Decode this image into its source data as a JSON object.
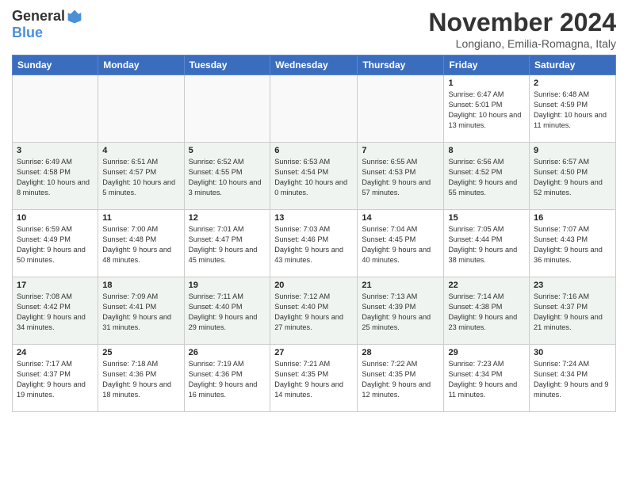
{
  "logo": {
    "general": "General",
    "blue": "Blue"
  },
  "header": {
    "title": "November 2024",
    "location": "Longiano, Emilia-Romagna, Italy"
  },
  "weekdays": [
    "Sunday",
    "Monday",
    "Tuesday",
    "Wednesday",
    "Thursday",
    "Friday",
    "Saturday"
  ],
  "weeks": [
    [
      {
        "day": "",
        "info": ""
      },
      {
        "day": "",
        "info": ""
      },
      {
        "day": "",
        "info": ""
      },
      {
        "day": "",
        "info": ""
      },
      {
        "day": "",
        "info": ""
      },
      {
        "day": "1",
        "info": "Sunrise: 6:47 AM\nSunset: 5:01 PM\nDaylight: 10 hours and 13 minutes."
      },
      {
        "day": "2",
        "info": "Sunrise: 6:48 AM\nSunset: 4:59 PM\nDaylight: 10 hours and 11 minutes."
      }
    ],
    [
      {
        "day": "3",
        "info": "Sunrise: 6:49 AM\nSunset: 4:58 PM\nDaylight: 10 hours and 8 minutes."
      },
      {
        "day": "4",
        "info": "Sunrise: 6:51 AM\nSunset: 4:57 PM\nDaylight: 10 hours and 5 minutes."
      },
      {
        "day": "5",
        "info": "Sunrise: 6:52 AM\nSunset: 4:55 PM\nDaylight: 10 hours and 3 minutes."
      },
      {
        "day": "6",
        "info": "Sunrise: 6:53 AM\nSunset: 4:54 PM\nDaylight: 10 hours and 0 minutes."
      },
      {
        "day": "7",
        "info": "Sunrise: 6:55 AM\nSunset: 4:53 PM\nDaylight: 9 hours and 57 minutes."
      },
      {
        "day": "8",
        "info": "Sunrise: 6:56 AM\nSunset: 4:52 PM\nDaylight: 9 hours and 55 minutes."
      },
      {
        "day": "9",
        "info": "Sunrise: 6:57 AM\nSunset: 4:50 PM\nDaylight: 9 hours and 52 minutes."
      }
    ],
    [
      {
        "day": "10",
        "info": "Sunrise: 6:59 AM\nSunset: 4:49 PM\nDaylight: 9 hours and 50 minutes."
      },
      {
        "day": "11",
        "info": "Sunrise: 7:00 AM\nSunset: 4:48 PM\nDaylight: 9 hours and 48 minutes."
      },
      {
        "day": "12",
        "info": "Sunrise: 7:01 AM\nSunset: 4:47 PM\nDaylight: 9 hours and 45 minutes."
      },
      {
        "day": "13",
        "info": "Sunrise: 7:03 AM\nSunset: 4:46 PM\nDaylight: 9 hours and 43 minutes."
      },
      {
        "day": "14",
        "info": "Sunrise: 7:04 AM\nSunset: 4:45 PM\nDaylight: 9 hours and 40 minutes."
      },
      {
        "day": "15",
        "info": "Sunrise: 7:05 AM\nSunset: 4:44 PM\nDaylight: 9 hours and 38 minutes."
      },
      {
        "day": "16",
        "info": "Sunrise: 7:07 AM\nSunset: 4:43 PM\nDaylight: 9 hours and 36 minutes."
      }
    ],
    [
      {
        "day": "17",
        "info": "Sunrise: 7:08 AM\nSunset: 4:42 PM\nDaylight: 9 hours and 34 minutes."
      },
      {
        "day": "18",
        "info": "Sunrise: 7:09 AM\nSunset: 4:41 PM\nDaylight: 9 hours and 31 minutes."
      },
      {
        "day": "19",
        "info": "Sunrise: 7:11 AM\nSunset: 4:40 PM\nDaylight: 9 hours and 29 minutes."
      },
      {
        "day": "20",
        "info": "Sunrise: 7:12 AM\nSunset: 4:40 PM\nDaylight: 9 hours and 27 minutes."
      },
      {
        "day": "21",
        "info": "Sunrise: 7:13 AM\nSunset: 4:39 PM\nDaylight: 9 hours and 25 minutes."
      },
      {
        "day": "22",
        "info": "Sunrise: 7:14 AM\nSunset: 4:38 PM\nDaylight: 9 hours and 23 minutes."
      },
      {
        "day": "23",
        "info": "Sunrise: 7:16 AM\nSunset: 4:37 PM\nDaylight: 9 hours and 21 minutes."
      }
    ],
    [
      {
        "day": "24",
        "info": "Sunrise: 7:17 AM\nSunset: 4:37 PM\nDaylight: 9 hours and 19 minutes."
      },
      {
        "day": "25",
        "info": "Sunrise: 7:18 AM\nSunset: 4:36 PM\nDaylight: 9 hours and 18 minutes."
      },
      {
        "day": "26",
        "info": "Sunrise: 7:19 AM\nSunset: 4:36 PM\nDaylight: 9 hours and 16 minutes."
      },
      {
        "day": "27",
        "info": "Sunrise: 7:21 AM\nSunset: 4:35 PM\nDaylight: 9 hours and 14 minutes."
      },
      {
        "day": "28",
        "info": "Sunrise: 7:22 AM\nSunset: 4:35 PM\nDaylight: 9 hours and 12 minutes."
      },
      {
        "day": "29",
        "info": "Sunrise: 7:23 AM\nSunset: 4:34 PM\nDaylight: 9 hours and 11 minutes."
      },
      {
        "day": "30",
        "info": "Sunrise: 7:24 AM\nSunset: 4:34 PM\nDaylight: 9 hours and 9 minutes."
      }
    ]
  ]
}
